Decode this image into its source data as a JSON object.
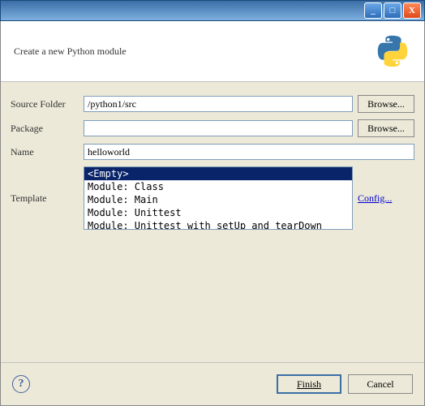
{
  "titlebar": {
    "min": "_",
    "max": "□",
    "close": "X"
  },
  "header": {
    "text": "Create a new Python module"
  },
  "form": {
    "source_folder": {
      "label": "Source Folder",
      "value": "/python1/src",
      "browse": "Browse..."
    },
    "package": {
      "label": "Package",
      "value": "",
      "browse": "Browse..."
    },
    "name": {
      "label": "Name",
      "value": "helloworld"
    },
    "template": {
      "label": "Template",
      "items": [
        "<Empty>",
        "Module: Class",
        "Module: Main",
        "Module: Unittest",
        "Module: Unittest with setUp and tearDown"
      ],
      "selected_index": 0,
      "config": "Config..."
    }
  },
  "footer": {
    "help": "?",
    "finish": "Finish",
    "cancel": "Cancel"
  }
}
